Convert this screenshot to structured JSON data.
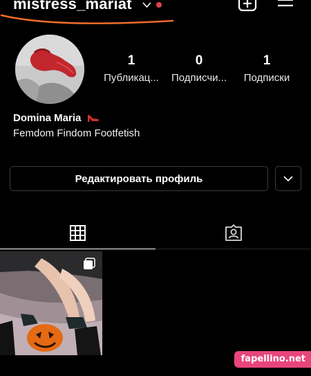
{
  "header": {
    "username": "mistress_mariat",
    "icons": [
      "chevron-down-icon",
      "notification-dot",
      "add-post-icon",
      "menu-icon"
    ],
    "accent_underline_color": "#f06b2a"
  },
  "stats": [
    {
      "value": "1",
      "label": "Публикац..."
    },
    {
      "value": "0",
      "label": "Подписчи..."
    },
    {
      "value": "1",
      "label": "Подписки"
    }
  ],
  "bio": {
    "name": "Domina Maria",
    "emoji": "high-heel",
    "text": "Femdom Findom Footfetish"
  },
  "actions": {
    "edit_profile": "Редактировать профиль"
  },
  "tabs": [
    {
      "icon": "grid-icon",
      "active": true
    },
    {
      "icon": "tagged-icon",
      "active": false
    }
  ],
  "watermark": "fapellino.net",
  "colors": {
    "background": "#000000",
    "text": "#ffffff",
    "dot": "#e0424b",
    "watermark_bg": "#e8457c"
  }
}
